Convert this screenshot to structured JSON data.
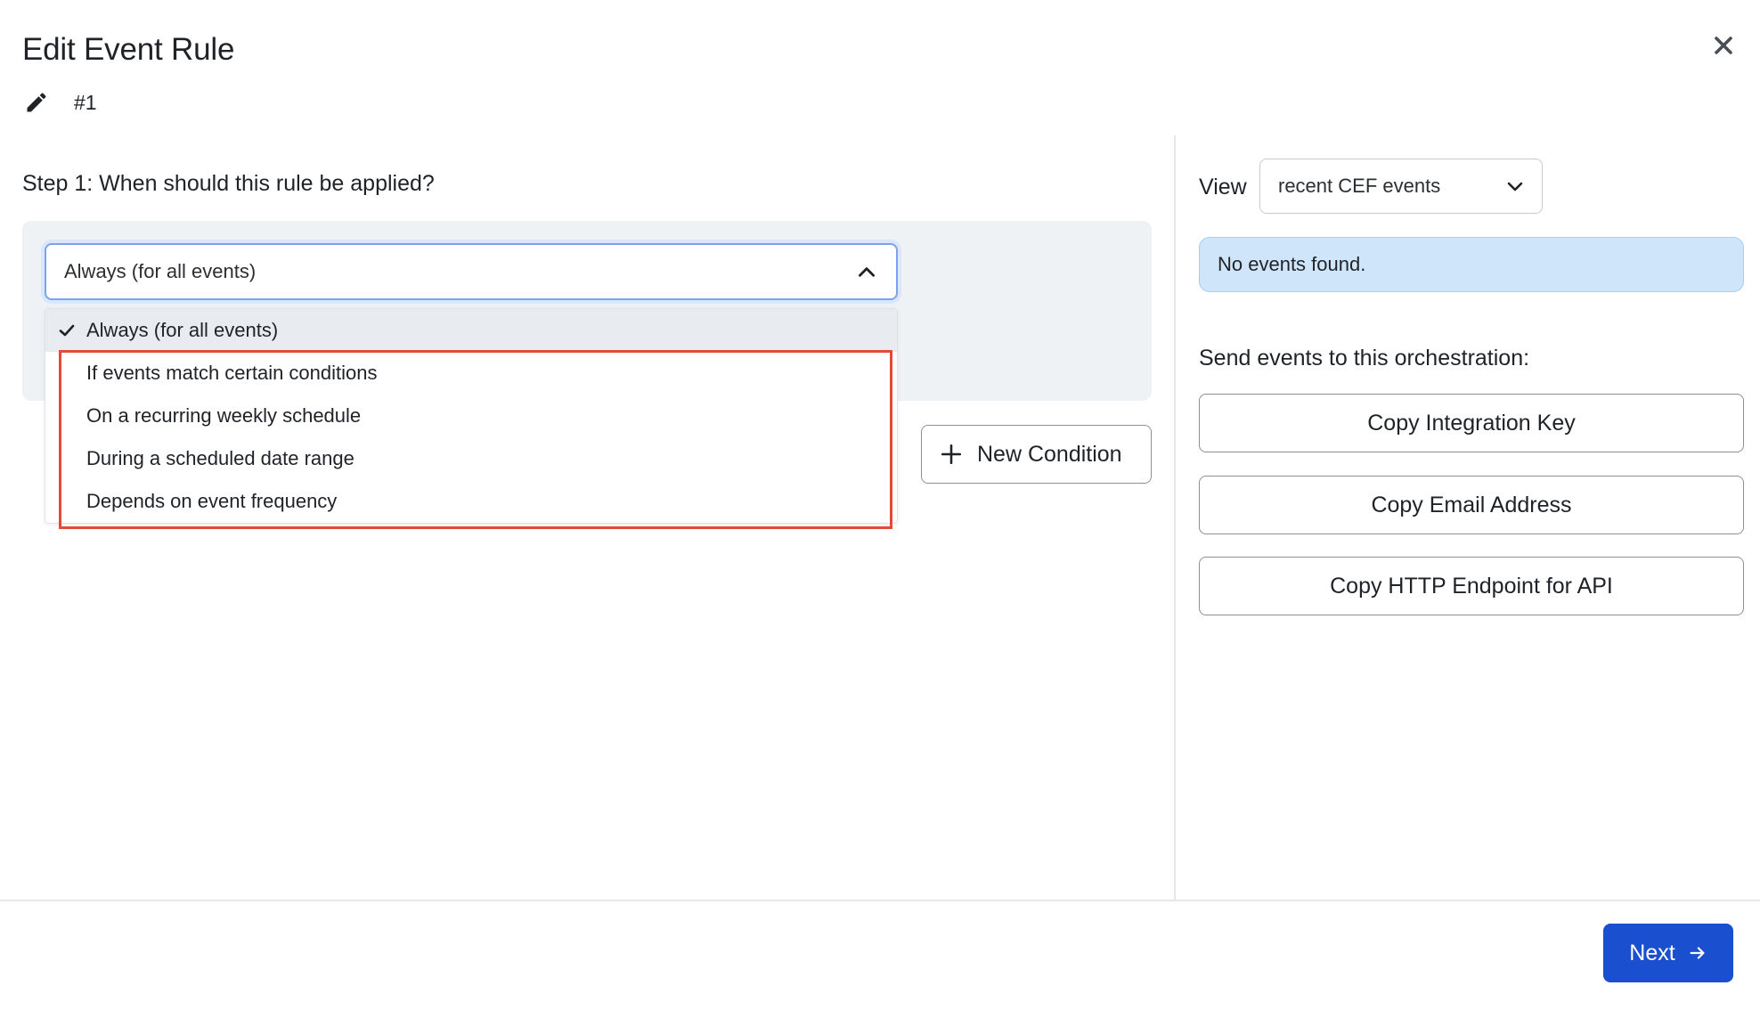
{
  "dialog": {
    "title": "Edit Event Rule",
    "rule_id": "#1",
    "close_icon": "close-icon",
    "edit_icon": "pencil-icon"
  },
  "step1": {
    "title": "Step 1: When should this rule be applied?",
    "selected_value": "Always (for all events)",
    "options": [
      "Always (for all events)",
      "If events match certain conditions",
      "On a recurring weekly schedule",
      "During a scheduled date range",
      "Depends on event frequency"
    ],
    "new_condition_label": "New Condition"
  },
  "sidebar": {
    "view_label": "View",
    "view_selected": "recent CEF events",
    "alert_text": "No events found.",
    "send_title": "Send events to this orchestration:",
    "copy_buttons": [
      "Copy Integration Key",
      "Copy Email Address",
      "Copy HTTP Endpoint for API"
    ]
  },
  "footer": {
    "next_label": "Next"
  },
  "colors": {
    "primary": "#1a4fd0",
    "alert_bg": "#cfe5f9",
    "highlight": "#e5493a",
    "panel_bg": "#eef2f5"
  }
}
